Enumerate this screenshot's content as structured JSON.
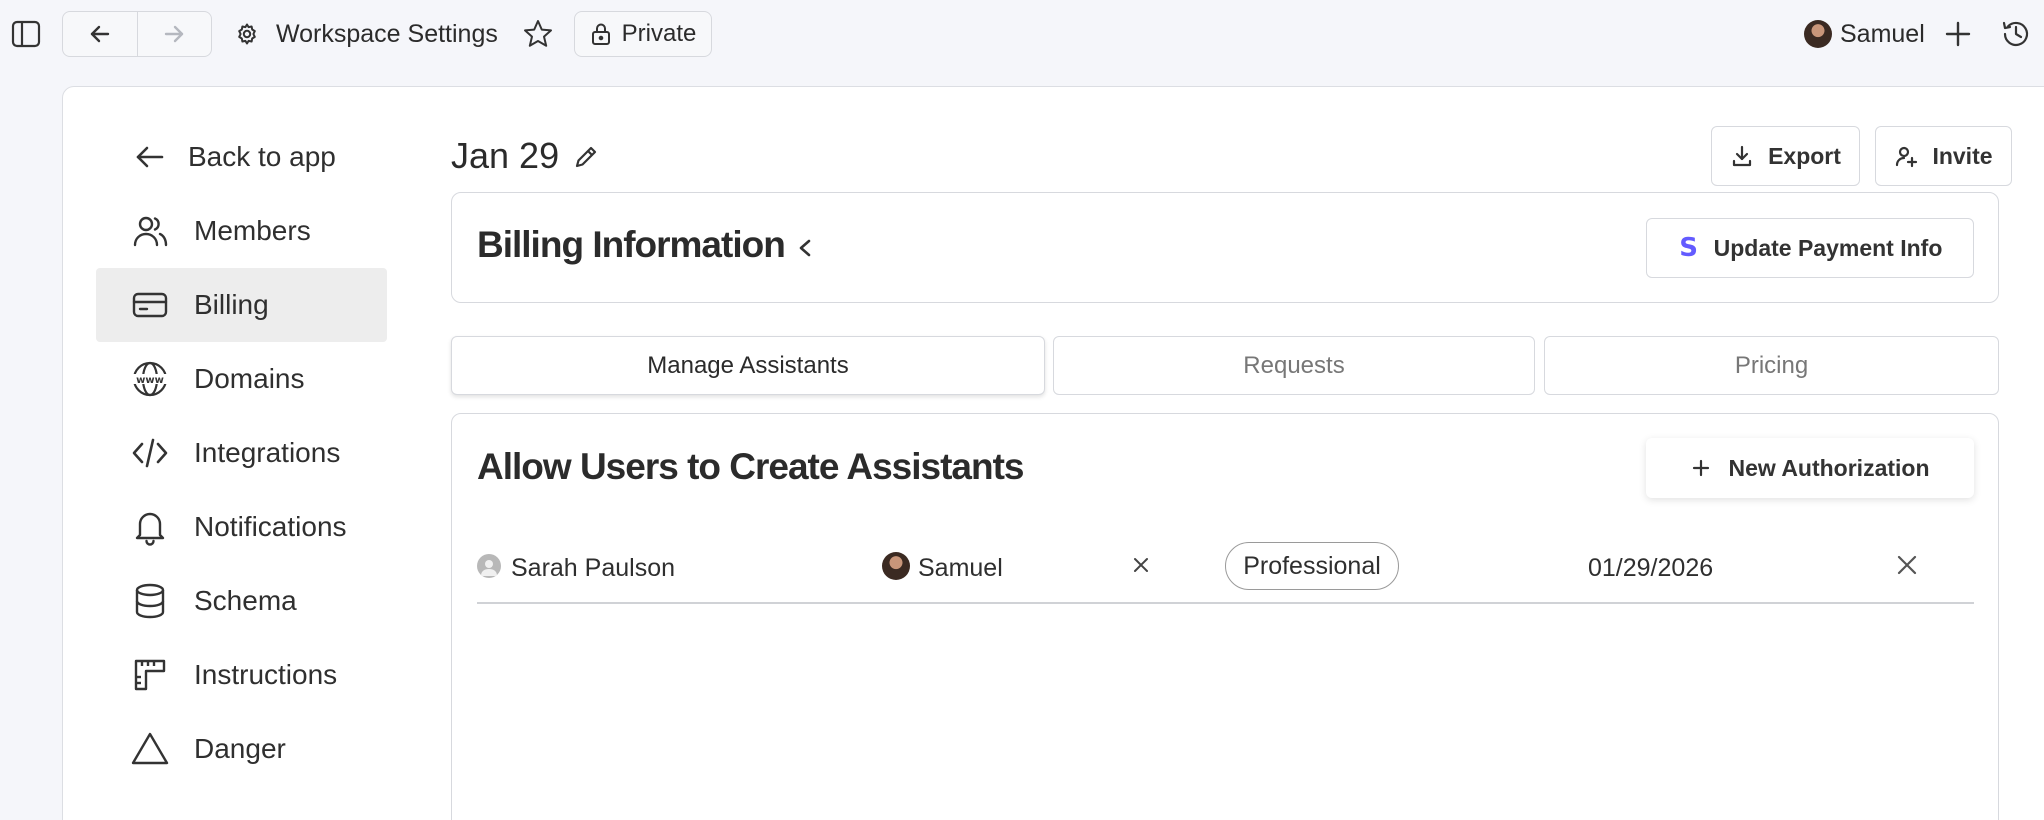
{
  "topbar": {
    "title": "Workspace Settings",
    "private_label": "Private",
    "user_name": "Samuel"
  },
  "sidebar": {
    "items": [
      {
        "label": "Back to app",
        "icon": "arrow-left-icon"
      },
      {
        "label": "Members",
        "icon": "users-icon"
      },
      {
        "label": "Billing",
        "icon": "credit-card-icon",
        "active": true
      },
      {
        "label": "Domains",
        "icon": "www-globe-icon"
      },
      {
        "label": "Integrations",
        "icon": "code-icon"
      },
      {
        "label": "Notifications",
        "icon": "bell-icon"
      },
      {
        "label": "Schema",
        "icon": "database-icon"
      },
      {
        "label": "Instructions",
        "icon": "ruler-icon"
      },
      {
        "label": "Danger",
        "icon": "triangle-icon"
      }
    ]
  },
  "main": {
    "page_title": "Jan 29",
    "export_label": "Export",
    "invite_label": "Invite",
    "billing": {
      "title": "Billing Information",
      "update_payment_label": "Update Payment Info",
      "stripe_glyph": "S"
    },
    "tabs": [
      {
        "label": "Manage Assistants",
        "active": true
      },
      {
        "label": "Requests",
        "active": false
      },
      {
        "label": "Pricing",
        "active": false
      }
    ],
    "assistants": {
      "title": "Allow Users to Create Assistants",
      "new_auth_label": "New Authorization",
      "rows": [
        {
          "user": "Sarah Paulson",
          "authorized_by": "Samuel",
          "plan": "Professional",
          "date": "01/29/2026"
        }
      ]
    }
  },
  "colors": {
    "accent_stripe": "#635bff",
    "active_sidebar_bg": "#ededed",
    "border": "#d7d9de"
  }
}
